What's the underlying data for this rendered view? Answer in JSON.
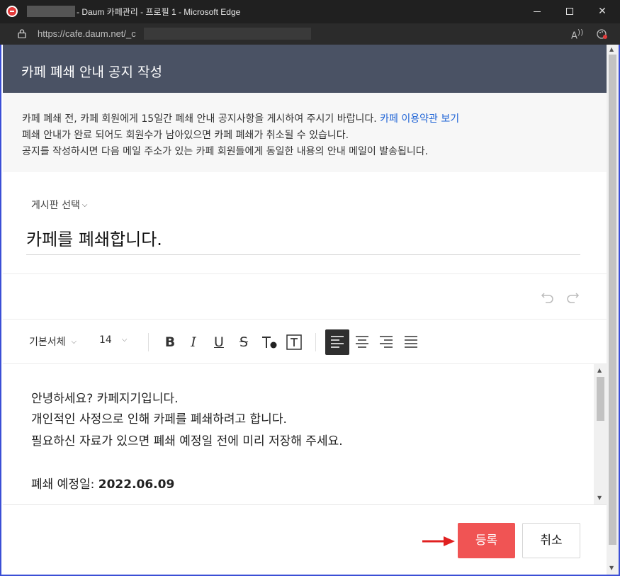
{
  "window": {
    "title": "- Daum 카페관리 - 프로필 1 - Microsoft Edge",
    "url": "https://cafe.daum.net/_c"
  },
  "header": {
    "title": "카페 폐쇄 안내 공지 작성"
  },
  "notice": {
    "line1": "카페 폐쇄 전, 카페 회원에게 15일간 폐쇄 안내 공지사항을 게시하여 주시기 바랍니다.",
    "terms_link": "카페 이용약관 보기",
    "line2": "폐쇄 안내가 완료 되어도 회원수가 남아있으면 카페 폐쇄가 취소될 수 있습니다.",
    "line3": "공지를 작성하시면 다음 메일 주소가 있는 카페 회원들에게 동일한 내용의 안내 메일이 발송됩니다."
  },
  "form": {
    "board_select_label": "게시판 선택",
    "post_title": "카페를 폐쇄합니다."
  },
  "toolbar": {
    "font_family": "기본서체",
    "font_size": "14"
  },
  "editor": {
    "line1": "안녕하세요? 카페지기입니다.",
    "line2": "개인적인 사정으로 인해 카페를 폐쇄하려고 합니다.",
    "line3": "필요하신 자료가 있으면 폐쇄 예정일 전에 미리 저장해 주세요.",
    "close_date_label": "폐쇄 예정일: ",
    "close_date_value": "2022.06.09"
  },
  "buttons": {
    "submit": "등록",
    "cancel": "취소"
  },
  "colors": {
    "header_bg": "#4a5264",
    "submit_bg": "#f05454",
    "link": "#1e63d6",
    "annotation_arrow": "#e02020"
  }
}
